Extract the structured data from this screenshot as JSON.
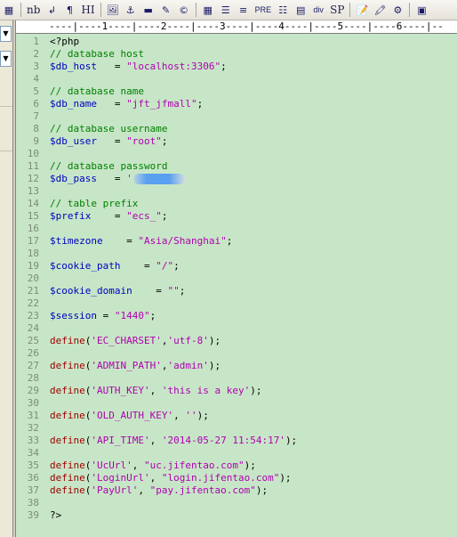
{
  "toolbar": {
    "buttons": [
      {
        "name": "color-grid-icon",
        "glyph": "▦"
      },
      {
        "name": "nbsp-button",
        "label": "nb"
      },
      {
        "name": "line-break-icon",
        "glyph": "↲"
      },
      {
        "name": "paragraph-icon",
        "glyph": "¶"
      },
      {
        "name": "heading-button",
        "label": "HI"
      },
      {
        "name": "image-icon",
        "glyph": "🖼"
      },
      {
        "name": "anchor-icon",
        "glyph": "⚓"
      },
      {
        "name": "horizontal-rule-icon",
        "glyph": "▬"
      },
      {
        "name": "edit-icon",
        "glyph": "✎"
      },
      {
        "name": "copyright-icon",
        "glyph": "©"
      },
      {
        "name": "table-icon",
        "glyph": "▦"
      },
      {
        "name": "table-rows-icon",
        "glyph": "☰"
      },
      {
        "name": "align-icon",
        "glyph": "≡"
      },
      {
        "name": "pre-button",
        "label": "PRE"
      },
      {
        "name": "list-icon",
        "glyph": "☷"
      },
      {
        "name": "bookmark-icon",
        "glyph": "▤"
      },
      {
        "name": "div-button",
        "label": "div"
      },
      {
        "name": "sp-button",
        "label": "SP"
      },
      {
        "name": "notepad-icon",
        "glyph": "📝"
      },
      {
        "name": "highlighter-icon",
        "glyph": "🖍"
      },
      {
        "name": "tools-icon",
        "glyph": "⚙"
      },
      {
        "name": "panel-icon",
        "glyph": "▣"
      }
    ]
  },
  "ruler": {
    "text": "----|----1----|----2----|----3----|----4----|----5----|----6----|--"
  },
  "colors": {
    "editor_bg": "#c7e6c7",
    "comment": "#008000",
    "variable": "#0000c0",
    "string": "#b000b0",
    "function": "#a00000",
    "line_number": "#7d8c7d"
  },
  "editor": {
    "lines": [
      {
        "n": "1",
        "tokens": [
          {
            "t": "<?php",
            "c": "tag"
          }
        ]
      },
      {
        "n": "2",
        "tokens": [
          {
            "t": "// database host",
            "c": "comment"
          }
        ]
      },
      {
        "n": "3",
        "tokens": [
          {
            "t": "$db_host",
            "c": "var"
          },
          {
            "t": "   = ",
            "c": "plain"
          },
          {
            "t": "\"localhost:3306\"",
            "c": "string"
          },
          {
            "t": ";",
            "c": "plain"
          }
        ]
      },
      {
        "n": "4",
        "tokens": []
      },
      {
        "n": "5",
        "tokens": [
          {
            "t": "// database name",
            "c": "comment"
          }
        ]
      },
      {
        "n": "6",
        "tokens": [
          {
            "t": "$db_name",
            "c": "var"
          },
          {
            "t": "   = ",
            "c": "plain"
          },
          {
            "t": "\"jft_jfmall\"",
            "c": "string"
          },
          {
            "t": ";",
            "c": "plain"
          }
        ]
      },
      {
        "n": "7",
        "tokens": []
      },
      {
        "n": "8",
        "tokens": [
          {
            "t": "// database username",
            "c": "comment"
          }
        ]
      },
      {
        "n": "9",
        "tokens": [
          {
            "t": "$db_user",
            "c": "var"
          },
          {
            "t": "   = ",
            "c": "plain"
          },
          {
            "t": "\"root\"",
            "c": "string"
          },
          {
            "t": ";",
            "c": "plain"
          }
        ]
      },
      {
        "n": "10",
        "tokens": []
      },
      {
        "n": "11",
        "tokens": [
          {
            "t": "// database password",
            "c": "comment"
          }
        ]
      },
      {
        "n": "12",
        "tokens": [
          {
            "t": "$db_pass",
            "c": "var"
          },
          {
            "t": "   = ",
            "c": "plain"
          },
          {
            "t": "'",
            "c": "string"
          }
        ],
        "redacted": true
      },
      {
        "n": "13",
        "tokens": []
      },
      {
        "n": "14",
        "tokens": [
          {
            "t": "// table prefix",
            "c": "comment"
          }
        ]
      },
      {
        "n": "15",
        "tokens": [
          {
            "t": "$prefix",
            "c": "var"
          },
          {
            "t": "    = ",
            "c": "plain"
          },
          {
            "t": "\"ecs_\"",
            "c": "string"
          },
          {
            "t": ";",
            "c": "plain"
          }
        ]
      },
      {
        "n": "16",
        "tokens": []
      },
      {
        "n": "17",
        "tokens": [
          {
            "t": "$timezone",
            "c": "var"
          },
          {
            "t": "    = ",
            "c": "plain"
          },
          {
            "t": "\"Asia/Shanghai\"",
            "c": "string"
          },
          {
            "t": ";",
            "c": "plain"
          }
        ]
      },
      {
        "n": "18",
        "tokens": []
      },
      {
        "n": "19",
        "tokens": [
          {
            "t": "$cookie_path",
            "c": "var"
          },
          {
            "t": "    = ",
            "c": "plain"
          },
          {
            "t": "\"/\"",
            "c": "string"
          },
          {
            "t": ";",
            "c": "plain"
          }
        ]
      },
      {
        "n": "20",
        "tokens": []
      },
      {
        "n": "21",
        "tokens": [
          {
            "t": "$cookie_domain",
            "c": "var"
          },
          {
            "t": "    = ",
            "c": "plain"
          },
          {
            "t": "\"\"",
            "c": "string"
          },
          {
            "t": ";",
            "c": "plain"
          }
        ]
      },
      {
        "n": "22",
        "tokens": []
      },
      {
        "n": "23",
        "tokens": [
          {
            "t": "$session",
            "c": "var"
          },
          {
            "t": " = ",
            "c": "plain"
          },
          {
            "t": "\"1440\"",
            "c": "string"
          },
          {
            "t": ";",
            "c": "plain"
          }
        ]
      },
      {
        "n": "24",
        "tokens": []
      },
      {
        "n": "25",
        "tokens": [
          {
            "t": "define",
            "c": "func"
          },
          {
            "t": "(",
            "c": "plain"
          },
          {
            "t": "'EC_CHARSET'",
            "c": "string"
          },
          {
            "t": ",",
            "c": "plain"
          },
          {
            "t": "'utf-8'",
            "c": "string"
          },
          {
            "t": ");",
            "c": "plain"
          }
        ]
      },
      {
        "n": "26",
        "tokens": []
      },
      {
        "n": "27",
        "tokens": [
          {
            "t": "define",
            "c": "func"
          },
          {
            "t": "(",
            "c": "plain"
          },
          {
            "t": "'ADMIN_PATH'",
            "c": "string"
          },
          {
            "t": ",",
            "c": "plain"
          },
          {
            "t": "'admin'",
            "c": "string"
          },
          {
            "t": ");",
            "c": "plain"
          }
        ]
      },
      {
        "n": "28",
        "tokens": []
      },
      {
        "n": "29",
        "tokens": [
          {
            "t": "define",
            "c": "func"
          },
          {
            "t": "(",
            "c": "plain"
          },
          {
            "t": "'AUTH_KEY'",
            "c": "string"
          },
          {
            "t": ", ",
            "c": "plain"
          },
          {
            "t": "'this is a key'",
            "c": "string"
          },
          {
            "t": ");",
            "c": "plain"
          }
        ]
      },
      {
        "n": "30",
        "tokens": []
      },
      {
        "n": "31",
        "tokens": [
          {
            "t": "define",
            "c": "func"
          },
          {
            "t": "(",
            "c": "plain"
          },
          {
            "t": "'OLD_AUTH_KEY'",
            "c": "string"
          },
          {
            "t": ", ",
            "c": "plain"
          },
          {
            "t": "''",
            "c": "string"
          },
          {
            "t": ");",
            "c": "plain"
          }
        ]
      },
      {
        "n": "32",
        "tokens": []
      },
      {
        "n": "33",
        "tokens": [
          {
            "t": "define",
            "c": "func"
          },
          {
            "t": "(",
            "c": "plain"
          },
          {
            "t": "'API_TIME'",
            "c": "string"
          },
          {
            "t": ", ",
            "c": "plain"
          },
          {
            "t": "'2014-05-27 11:54:17'",
            "c": "string"
          },
          {
            "t": ");",
            "c": "plain"
          }
        ]
      },
      {
        "n": "34",
        "tokens": []
      },
      {
        "n": "35",
        "tokens": [
          {
            "t": "define",
            "c": "func"
          },
          {
            "t": "(",
            "c": "plain"
          },
          {
            "t": "'UcUrl'",
            "c": "string"
          },
          {
            "t": ", ",
            "c": "plain"
          },
          {
            "t": "\"uc.jifentao.com\"",
            "c": "string"
          },
          {
            "t": ");",
            "c": "plain"
          }
        ]
      },
      {
        "n": "36",
        "tokens": [
          {
            "t": "define",
            "c": "func"
          },
          {
            "t": "(",
            "c": "plain"
          },
          {
            "t": "'LoginUrl'",
            "c": "string"
          },
          {
            "t": ", ",
            "c": "plain"
          },
          {
            "t": "\"login.jifentao.com\"",
            "c": "string"
          },
          {
            "t": ");",
            "c": "plain"
          }
        ]
      },
      {
        "n": "37",
        "tokens": [
          {
            "t": "define",
            "c": "func"
          },
          {
            "t": "(",
            "c": "plain"
          },
          {
            "t": "'PayUrl'",
            "c": "string"
          },
          {
            "t": ", ",
            "c": "plain"
          },
          {
            "t": "\"pay.jifentao.com\"",
            "c": "string"
          },
          {
            "t": ");",
            "c": "plain"
          }
        ]
      },
      {
        "n": "38",
        "tokens": []
      },
      {
        "n": "39",
        "tokens": [
          {
            "t": "?>",
            "c": "tag"
          }
        ]
      }
    ]
  }
}
